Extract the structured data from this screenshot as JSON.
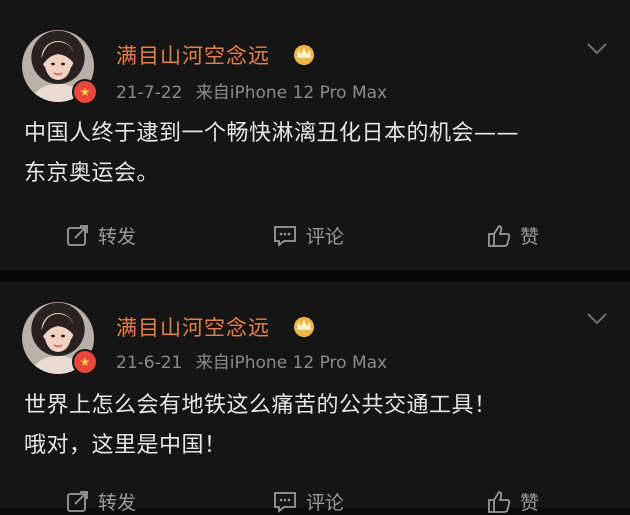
{
  "posts": [
    {
      "username": "满目山河空念远",
      "date": "21-7-22",
      "source": "来自iPhone 12 Pro Max",
      "lines": [
        "中国人终于逮到一个畅快淋漓丑化日本的机会——",
        "东京奥运会。"
      ],
      "actions": {
        "repost": "转发",
        "comment": "评论",
        "like": "赞"
      }
    },
    {
      "username": "满目山河空念远",
      "date": "21-6-21",
      "source": "来自iPhone 12 Pro Max",
      "lines": [
        "世界上怎么会有地铁这么痛苦的公共交通工具！",
        "哦对，这里是中国！"
      ],
      "actions": {
        "repost": "转发",
        "comment": "评论",
        "like": "赞"
      }
    }
  ],
  "colors": {
    "username": "#e77f4c",
    "meta": "#8b8b8b",
    "text": "#e6e6e6",
    "background": "#151515"
  },
  "icons": [
    "avatar",
    "verified-badge-icon",
    "crown-icon",
    "chevron-down-icon",
    "repost-icon",
    "comment-icon",
    "like-icon"
  ]
}
